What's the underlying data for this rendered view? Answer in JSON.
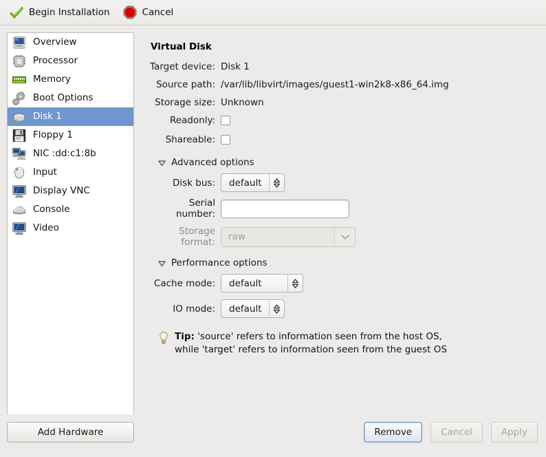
{
  "toolbar": {
    "begin_label": "Begin Installation",
    "cancel_label": "Cancel",
    "begin_icon": "green-check-icon",
    "cancel_icon": "red-stop-icon"
  },
  "sidebar": {
    "items": [
      {
        "label": "Overview",
        "icon": "computer-icon",
        "selected": false
      },
      {
        "label": "Processor",
        "icon": "cpu-chip-icon",
        "selected": false
      },
      {
        "label": "Memory",
        "icon": "memory-ram-icon",
        "selected": false
      },
      {
        "label": "Boot Options",
        "icon": "gears-icon",
        "selected": false
      },
      {
        "label": "Disk 1",
        "icon": "harddisk-icon",
        "selected": true
      },
      {
        "label": "Floppy 1",
        "icon": "floppy-icon",
        "selected": false
      },
      {
        "label": "NIC :dd:c1:8b",
        "icon": "network-icon",
        "selected": false
      },
      {
        "label": "Input",
        "icon": "mouse-icon",
        "selected": false
      },
      {
        "label": "Display VNC",
        "icon": "display-icon",
        "selected": false
      },
      {
        "label": "Console",
        "icon": "console-icon",
        "selected": false
      },
      {
        "label": "Video",
        "icon": "video-icon",
        "selected": false
      }
    ]
  },
  "main": {
    "title": "Virtual Disk",
    "fields": {
      "target_device_label": "Target device:",
      "target_device_value": "Disk 1",
      "source_path_label": "Source path:",
      "source_path_value": "/var/lib/libvirt/images/guest1-win2k8-x86_64.img",
      "storage_size_label": "Storage size:",
      "storage_size_value": "Unknown",
      "readonly_label": "Readonly:",
      "readonly_checked": false,
      "shareable_label": "Shareable:",
      "shareable_checked": false
    },
    "advanced": {
      "section_label": "Advanced options",
      "expanded": true,
      "disk_bus_label": "Disk bus:",
      "disk_bus_value": "default",
      "serial_number_label": "Serial number:",
      "serial_number_value": "",
      "serial_number_placeholder": "",
      "storage_format_label": "Storage format:",
      "storage_format_value": "raw",
      "storage_format_disabled": true
    },
    "performance": {
      "section_label": "Performance options",
      "expanded": true,
      "cache_mode_label": "Cache mode:",
      "cache_mode_value": "default",
      "io_mode_label": "IO mode:",
      "io_mode_value": "default"
    },
    "tip": {
      "prefix": "Tip:",
      "line1": " 'source' refers to information seen from the host OS,",
      "line2": "while 'target' refers to information seen from the guest OS",
      "icon": "lightbulb-icon"
    }
  },
  "footer": {
    "add_hardware_label": "Add Hardware",
    "remove_label": "Remove",
    "cancel_label": "Cancel",
    "apply_label": "Apply",
    "remove_is_default": true,
    "cancel_disabled": true,
    "apply_disabled": true
  },
  "colors": {
    "selection": "#6f96ce",
    "background": "#ecebe9",
    "panel": "#ffffff",
    "accent_default_button": "#6f93c4"
  }
}
